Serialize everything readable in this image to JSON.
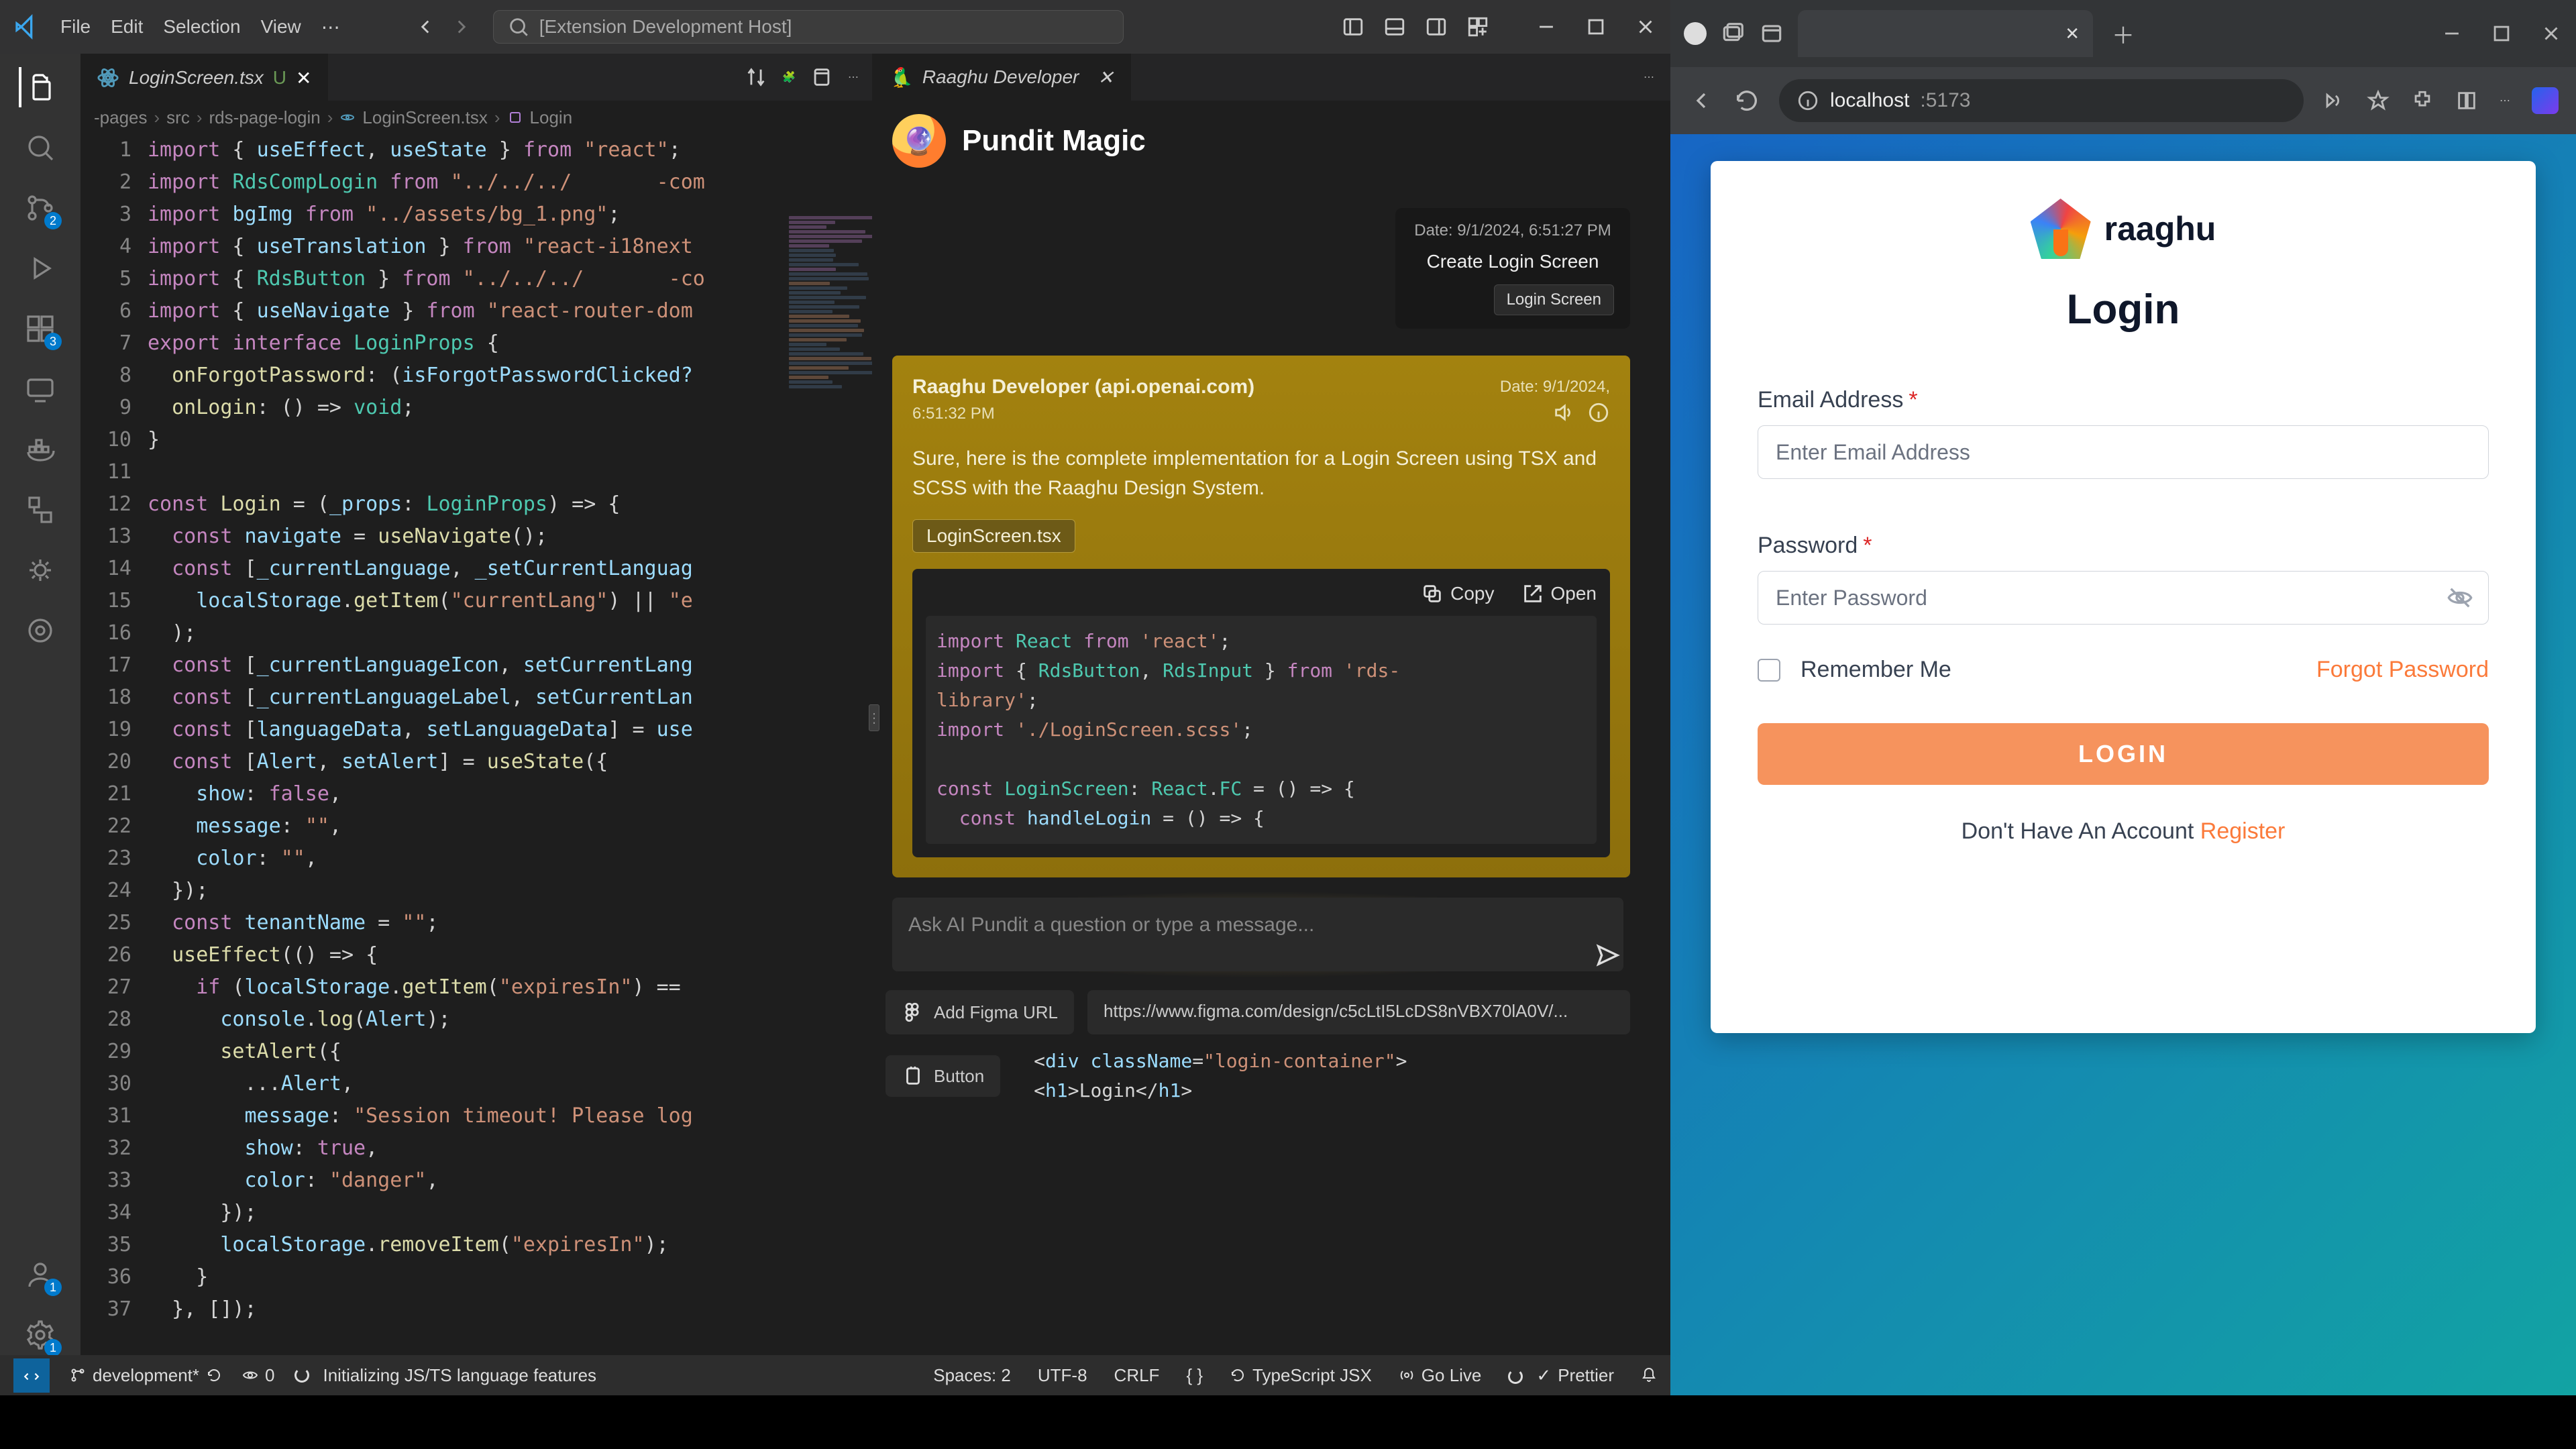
{
  "vscode": {
    "menu": [
      "File",
      "Edit",
      "Selection",
      "View"
    ],
    "search_placeholder": "[Extension Development Host]",
    "tab": {
      "filename": "LoginScreen.tsx",
      "modified": "U"
    },
    "breadcrumb": [
      "-pages",
      "src",
      "rds-page-login",
      "LoginScreen.tsx",
      "Login"
    ],
    "activity_badges": {
      "scm": "2",
      "extensions": "3",
      "accounts": "1",
      "settings": "1"
    },
    "code_lines": [
      [
        [
          "kw",
          "import"
        ],
        [
          "pn",
          " { "
        ],
        [
          "id",
          "useEffect"
        ],
        [
          "pn",
          ", "
        ],
        [
          "id",
          "useState"
        ],
        [
          "pn",
          " } "
        ],
        [
          "kw",
          "from"
        ],
        [
          "pn",
          " "
        ],
        [
          "st",
          "\"react\""
        ],
        [
          "pn",
          ";"
        ]
      ],
      [
        [
          "kw",
          "import"
        ],
        [
          "pn",
          " "
        ],
        [
          "ty",
          "RdsCompLogin"
        ],
        [
          "pn",
          " "
        ],
        [
          "kw",
          "from"
        ],
        [
          "pn",
          " "
        ],
        [
          "st",
          "\"../../../       -com"
        ]
      ],
      [
        [
          "kw",
          "import"
        ],
        [
          "pn",
          " "
        ],
        [
          "id",
          "bgImg"
        ],
        [
          "pn",
          " "
        ],
        [
          "kw",
          "from"
        ],
        [
          "pn",
          " "
        ],
        [
          "st",
          "\"../assets/bg_1.png\""
        ],
        [
          "pn",
          ";"
        ]
      ],
      [
        [
          "kw",
          "import"
        ],
        [
          "pn",
          " { "
        ],
        [
          "id",
          "useTranslation"
        ],
        [
          "pn",
          " } "
        ],
        [
          "kw",
          "from"
        ],
        [
          "pn",
          " "
        ],
        [
          "st",
          "\"react-i18next"
        ]
      ],
      [
        [
          "kw",
          "import"
        ],
        [
          "pn",
          " { "
        ],
        [
          "ty",
          "RdsButton"
        ],
        [
          "pn",
          " } "
        ],
        [
          "kw",
          "from"
        ],
        [
          "pn",
          " "
        ],
        [
          "st",
          "\"../../../       -co"
        ]
      ],
      [
        [
          "kw",
          "import"
        ],
        [
          "pn",
          " { "
        ],
        [
          "id",
          "useNavigate"
        ],
        [
          "pn",
          " } "
        ],
        [
          "kw",
          "from"
        ],
        [
          "pn",
          " "
        ],
        [
          "st",
          "\"react-router-dom"
        ]
      ],
      [
        [
          "kw",
          "export"
        ],
        [
          "pn",
          " "
        ],
        [
          "kw",
          "interface"
        ],
        [
          "pn",
          " "
        ],
        [
          "ty",
          "LoginProps"
        ],
        [
          "pn",
          " {"
        ]
      ],
      [
        [
          "pn",
          "  "
        ],
        [
          "fn",
          "onForgotPassword"
        ],
        [
          "pn",
          ": ("
        ],
        [
          "id",
          "isForgotPasswordClicked?"
        ]
      ],
      [
        [
          "pn",
          "  "
        ],
        [
          "fn",
          "onLogin"
        ],
        [
          "pn",
          ": () => "
        ],
        [
          "ty",
          "void"
        ],
        [
          "pn",
          ";"
        ]
      ],
      [
        [
          "pn",
          "}"
        ]
      ],
      [
        [
          "pn",
          " "
        ]
      ],
      [
        [
          "kw",
          "const"
        ],
        [
          "pn",
          " "
        ],
        [
          "fn",
          "Login"
        ],
        [
          "pn",
          " = ("
        ],
        [
          "id",
          "_props"
        ],
        [
          "pn",
          ": "
        ],
        [
          "ty",
          "LoginProps"
        ],
        [
          "pn",
          ") => {"
        ]
      ],
      [
        [
          "pn",
          "  "
        ],
        [
          "kw",
          "const"
        ],
        [
          "pn",
          " "
        ],
        [
          "id",
          "navigate"
        ],
        [
          "pn",
          " = "
        ],
        [
          "fn",
          "useNavigate"
        ],
        [
          "pn",
          "();"
        ]
      ],
      [
        [
          "pn",
          "  "
        ],
        [
          "kw",
          "const"
        ],
        [
          "pn",
          " ["
        ],
        [
          "id",
          "_currentLanguage"
        ],
        [
          "pn",
          ", "
        ],
        [
          "id",
          "_setCurrentLanguag"
        ]
      ],
      [
        [
          "pn",
          "    "
        ],
        [
          "id",
          "localStorage"
        ],
        [
          "pn",
          "."
        ],
        [
          "fn",
          "getItem"
        ],
        [
          "pn",
          "("
        ],
        [
          "st",
          "\"currentLang\""
        ],
        [
          "pn",
          ") || "
        ],
        [
          "st",
          "\"e"
        ]
      ],
      [
        [
          "pn",
          "  );"
        ]
      ],
      [
        [
          "pn",
          "  "
        ],
        [
          "kw",
          "const"
        ],
        [
          "pn",
          " ["
        ],
        [
          "id",
          "_currentLanguageIcon"
        ],
        [
          "pn",
          ", "
        ],
        [
          "id",
          "setCurrentLang"
        ]
      ],
      [
        [
          "pn",
          "  "
        ],
        [
          "kw",
          "const"
        ],
        [
          "pn",
          " ["
        ],
        [
          "id",
          "_currentLanguageLabel"
        ],
        [
          "pn",
          ", "
        ],
        [
          "id",
          "setCurrentLan"
        ]
      ],
      [
        [
          "pn",
          "  "
        ],
        [
          "kw",
          "const"
        ],
        [
          "pn",
          " ["
        ],
        [
          "id",
          "languageData"
        ],
        [
          "pn",
          ", "
        ],
        [
          "id",
          "setLanguageData"
        ],
        [
          "pn",
          "] = "
        ],
        [
          "id",
          "use"
        ]
      ],
      [
        [
          "pn",
          "  "
        ],
        [
          "kw",
          "const"
        ],
        [
          "pn",
          " ["
        ],
        [
          "id",
          "Alert"
        ],
        [
          "pn",
          ", "
        ],
        [
          "id",
          "setAlert"
        ],
        [
          "pn",
          "] = "
        ],
        [
          "fn",
          "useState"
        ],
        [
          "pn",
          "({"
        ]
      ],
      [
        [
          "pn",
          "    "
        ],
        [
          "id",
          "show"
        ],
        [
          "pn",
          ": "
        ],
        [
          "kw",
          "false"
        ],
        [
          "pn",
          ","
        ]
      ],
      [
        [
          "pn",
          "    "
        ],
        [
          "id",
          "message"
        ],
        [
          "pn",
          ": "
        ],
        [
          "st",
          "\"\""
        ],
        [
          "pn",
          ","
        ]
      ],
      [
        [
          "pn",
          "    "
        ],
        [
          "id",
          "color"
        ],
        [
          "pn",
          ": "
        ],
        [
          "st",
          "\"\""
        ],
        [
          "pn",
          ","
        ]
      ],
      [
        [
          "pn",
          "  });"
        ]
      ],
      [
        [
          "pn",
          "  "
        ],
        [
          "kw",
          "const"
        ],
        [
          "pn",
          " "
        ],
        [
          "id",
          "tenantName"
        ],
        [
          "pn",
          " = "
        ],
        [
          "st",
          "\"\""
        ],
        [
          "pn",
          ";"
        ]
      ],
      [
        [
          "pn",
          "  "
        ],
        [
          "fn",
          "useEffect"
        ],
        [
          "pn",
          "(() => {"
        ]
      ],
      [
        [
          "pn",
          "    "
        ],
        [
          "kw",
          "if"
        ],
        [
          "pn",
          " ("
        ],
        [
          "id",
          "localStorage"
        ],
        [
          "pn",
          "."
        ],
        [
          "fn",
          "getItem"
        ],
        [
          "pn",
          "("
        ],
        [
          "st",
          "\"expiresIn\""
        ],
        [
          "pn",
          ") =="
        ]
      ],
      [
        [
          "pn",
          "      "
        ],
        [
          "id",
          "console"
        ],
        [
          "pn",
          "."
        ],
        [
          "fn",
          "log"
        ],
        [
          "pn",
          "("
        ],
        [
          "id",
          "Alert"
        ],
        [
          "pn",
          ");"
        ]
      ],
      [
        [
          "pn",
          "      "
        ],
        [
          "fn",
          "setAlert"
        ],
        [
          "pn",
          "({"
        ]
      ],
      [
        [
          "pn",
          "        ..."
        ],
        [
          "id",
          "Alert"
        ],
        [
          "pn",
          ","
        ]
      ],
      [
        [
          "pn",
          "        "
        ],
        [
          "id",
          "message"
        ],
        [
          "pn",
          ": "
        ],
        [
          "st",
          "\"Session timeout! Please log"
        ]
      ],
      [
        [
          "pn",
          "        "
        ],
        [
          "id",
          "show"
        ],
        [
          "pn",
          ": "
        ],
        [
          "kw",
          "true"
        ],
        [
          "pn",
          ","
        ]
      ],
      [
        [
          "pn",
          "        "
        ],
        [
          "id",
          "color"
        ],
        [
          "pn",
          ": "
        ],
        [
          "st",
          "\"danger\""
        ],
        [
          "pn",
          ","
        ]
      ],
      [
        [
          "pn",
          "      });"
        ]
      ],
      [
        [
          "pn",
          "      "
        ],
        [
          "id",
          "localStorage"
        ],
        [
          "pn",
          "."
        ],
        [
          "fn",
          "removeItem"
        ],
        [
          "pn",
          "("
        ],
        [
          "st",
          "\"expiresIn\""
        ],
        [
          "pn",
          ");"
        ]
      ],
      [
        [
          "pn",
          "    }"
        ]
      ],
      [
        [
          "pn",
          "  }, []);"
        ]
      ]
    ],
    "statusbar": {
      "branch": "development*",
      "ports": "0",
      "init": "Initializing JS/TS language features",
      "spaces": "Spaces: 2",
      "encoding": "UTF-8",
      "eol": "CRLF",
      "lang": "TypeScript JSX",
      "golive": "Go Live",
      "prettier": "Prettier"
    }
  },
  "chat": {
    "tab_label": "Raaghu Developer",
    "title": "Pundit Magic",
    "prompt": {
      "date": "Date: 9/1/2024, 6:51:27 PM",
      "text": "Create Login Screen",
      "chip": "Login Screen"
    },
    "assistant": {
      "name": "Raaghu Developer (api.openai.com)",
      "date": "Date: 9/1/2024,",
      "time": "6:51:32 PM",
      "body": "Sure, here is the complete implementation for a Login Screen using TSX and SCSS with the Raaghu Design System.",
      "file_chip": "LoginScreen.tsx",
      "copy": "Copy",
      "open": "Open",
      "code": [
        [
          [
            "ck",
            "import"
          ],
          [
            "cp",
            " "
          ],
          [
            "ct",
            "React"
          ],
          [
            "cp",
            " "
          ],
          [
            "ck",
            "from"
          ],
          [
            "cp",
            " "
          ],
          [
            "cs",
            "'react'"
          ],
          [
            "cp",
            ";"
          ]
        ],
        [
          [
            "ck",
            "import"
          ],
          [
            "cp",
            " { "
          ],
          [
            "ct",
            "RdsButton"
          ],
          [
            "cp",
            ", "
          ],
          [
            "ct",
            "RdsInput"
          ],
          [
            "cp",
            " } "
          ],
          [
            "ck",
            "from"
          ],
          [
            "cp",
            " "
          ],
          [
            "cs",
            "'rds-"
          ]
        ],
        [
          [
            "cs",
            "library'"
          ],
          [
            "cp",
            ";"
          ]
        ],
        [
          [
            "ck",
            "import"
          ],
          [
            "cp",
            " "
          ],
          [
            "cs",
            "'./LoginScreen.scss'"
          ],
          [
            "cp",
            ";"
          ]
        ],
        [
          [
            "cp",
            " "
          ]
        ],
        [
          [
            "ck",
            "const"
          ],
          [
            "cp",
            " "
          ],
          [
            "ct",
            "LoginScreen"
          ],
          [
            "cp",
            ": "
          ],
          [
            "ct",
            "React"
          ],
          [
            "cp",
            "."
          ],
          [
            "ct",
            "FC"
          ],
          [
            "cp",
            " = () => {"
          ]
        ],
        [
          [
            "cp",
            "  "
          ],
          [
            "ck",
            "const"
          ],
          [
            "cp",
            " "
          ],
          [
            "ci",
            "handleLogin"
          ],
          [
            "cp",
            " = () => {"
          ]
        ]
      ]
    },
    "input_placeholder": "Ask AI Pundit a question or type a message...",
    "figma_btn": "Add Figma URL",
    "figma_url": "https://www.figma.com/design/c5cLtI5LcDS8nVBX70lA0V/...",
    "ui_chip": "Button",
    "snippet_extra": [
      [
        [
          "cp",
          "<"
        ],
        [
          "ci",
          "div"
        ],
        [
          "cp",
          " "
        ],
        [
          "ci",
          "className"
        ],
        [
          "cp",
          "="
        ],
        [
          "cs",
          "\"login-container\""
        ],
        [
          "cp",
          ">"
        ]
      ],
      [
        [
          "cp",
          "  <"
        ],
        [
          "ci",
          "h1"
        ],
        [
          "cp",
          ">"
        ],
        [
          "cp",
          "Login"
        ],
        [
          "cp",
          "</"
        ],
        [
          "ci",
          "h1"
        ],
        [
          "cp",
          ">"
        ]
      ]
    ]
  },
  "browser": {
    "address": {
      "host": "localhost",
      "port": ":5173"
    },
    "login": {
      "brand": "raaghu",
      "heading": "Login",
      "email_label": "Email Address",
      "email_placeholder": "Enter Email Address",
      "password_label": "Password",
      "password_placeholder": "Enter Password",
      "remember": "Remember Me",
      "forgot": "Forgot Password",
      "submit": "LOGIN",
      "noacct": "Don't Have An Account ",
      "register": "Register"
    }
  }
}
